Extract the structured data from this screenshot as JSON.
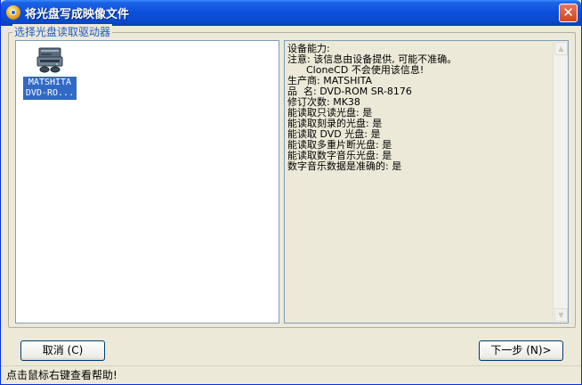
{
  "window": {
    "title": "将光盘写成映像文件",
    "close_glyph": "✕"
  },
  "group": {
    "label": "选择光盘读取驱动器"
  },
  "drives": [
    {
      "label": "MATSHITA DVD-RO...",
      "icon": "optical-drive-icon"
    }
  ],
  "info": {
    "text": "设备能力:\n注意: 该信息由设备提供, 可能不准确。\n      CloneCD 不会使用该信息!\n生产商: MATSHITA\n品  名: DVD-ROM SR-8176\n修订次数: MK38\n能读取只读光盘: 是\n能读取刻录的光盘: 是\n能读取 DVD 光盘: 是\n能读取多重片断光盘: 是\n能读取数字音乐光盘: 是\n数字音乐数据是准确的: 是"
  },
  "buttons": {
    "cancel_label": "取消 (C)",
    "next_label": "下一步 (N)>"
  },
  "status": {
    "text": "点击鼠标右键查看帮助!"
  },
  "colors": {
    "titlebar": "#0A4FDB",
    "selection": "#316AC5",
    "group_label": "#1E5AC8",
    "window_bg": "#ECE9D8"
  }
}
